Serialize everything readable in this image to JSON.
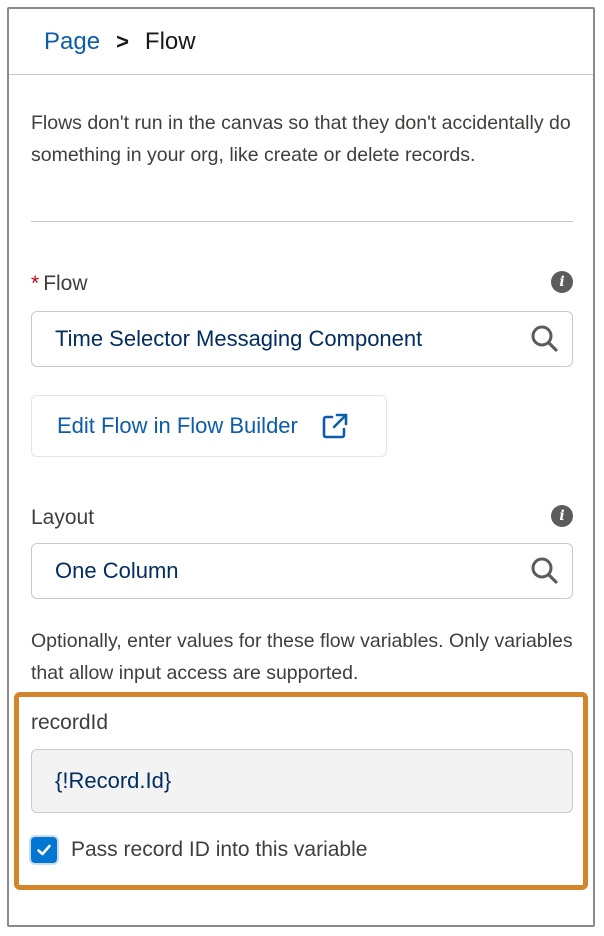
{
  "breadcrumb": {
    "parent": "Page",
    "separator": ">",
    "current": "Flow"
  },
  "description": "Flows don't run in the canvas so that they don't accidentally do something in your org, like create or delete records.",
  "flow_field": {
    "required_marker": "*",
    "label": "Flow",
    "value": "Time Selector Messaging Component",
    "info_icon": "info-icon",
    "search_icon": "search-icon"
  },
  "edit_button": {
    "label": "Edit Flow in Flow Builder",
    "icon": "external-link-icon"
  },
  "layout_field": {
    "label": "Layout",
    "value": "One Column",
    "info_icon": "info-icon",
    "search_icon": "search-icon"
  },
  "help_text": "Optionally, enter values for these flow variables. Only variables that allow input access are supported.",
  "record_id": {
    "label": "recordId",
    "value": "{!Record.Id}",
    "checkbox_label": "Pass record ID into this variable",
    "checked": true
  },
  "colors": {
    "link": "#0b5cab",
    "highlight_border": "#d4842a",
    "checkbox": "#0176d3",
    "required": "#ba0517"
  }
}
